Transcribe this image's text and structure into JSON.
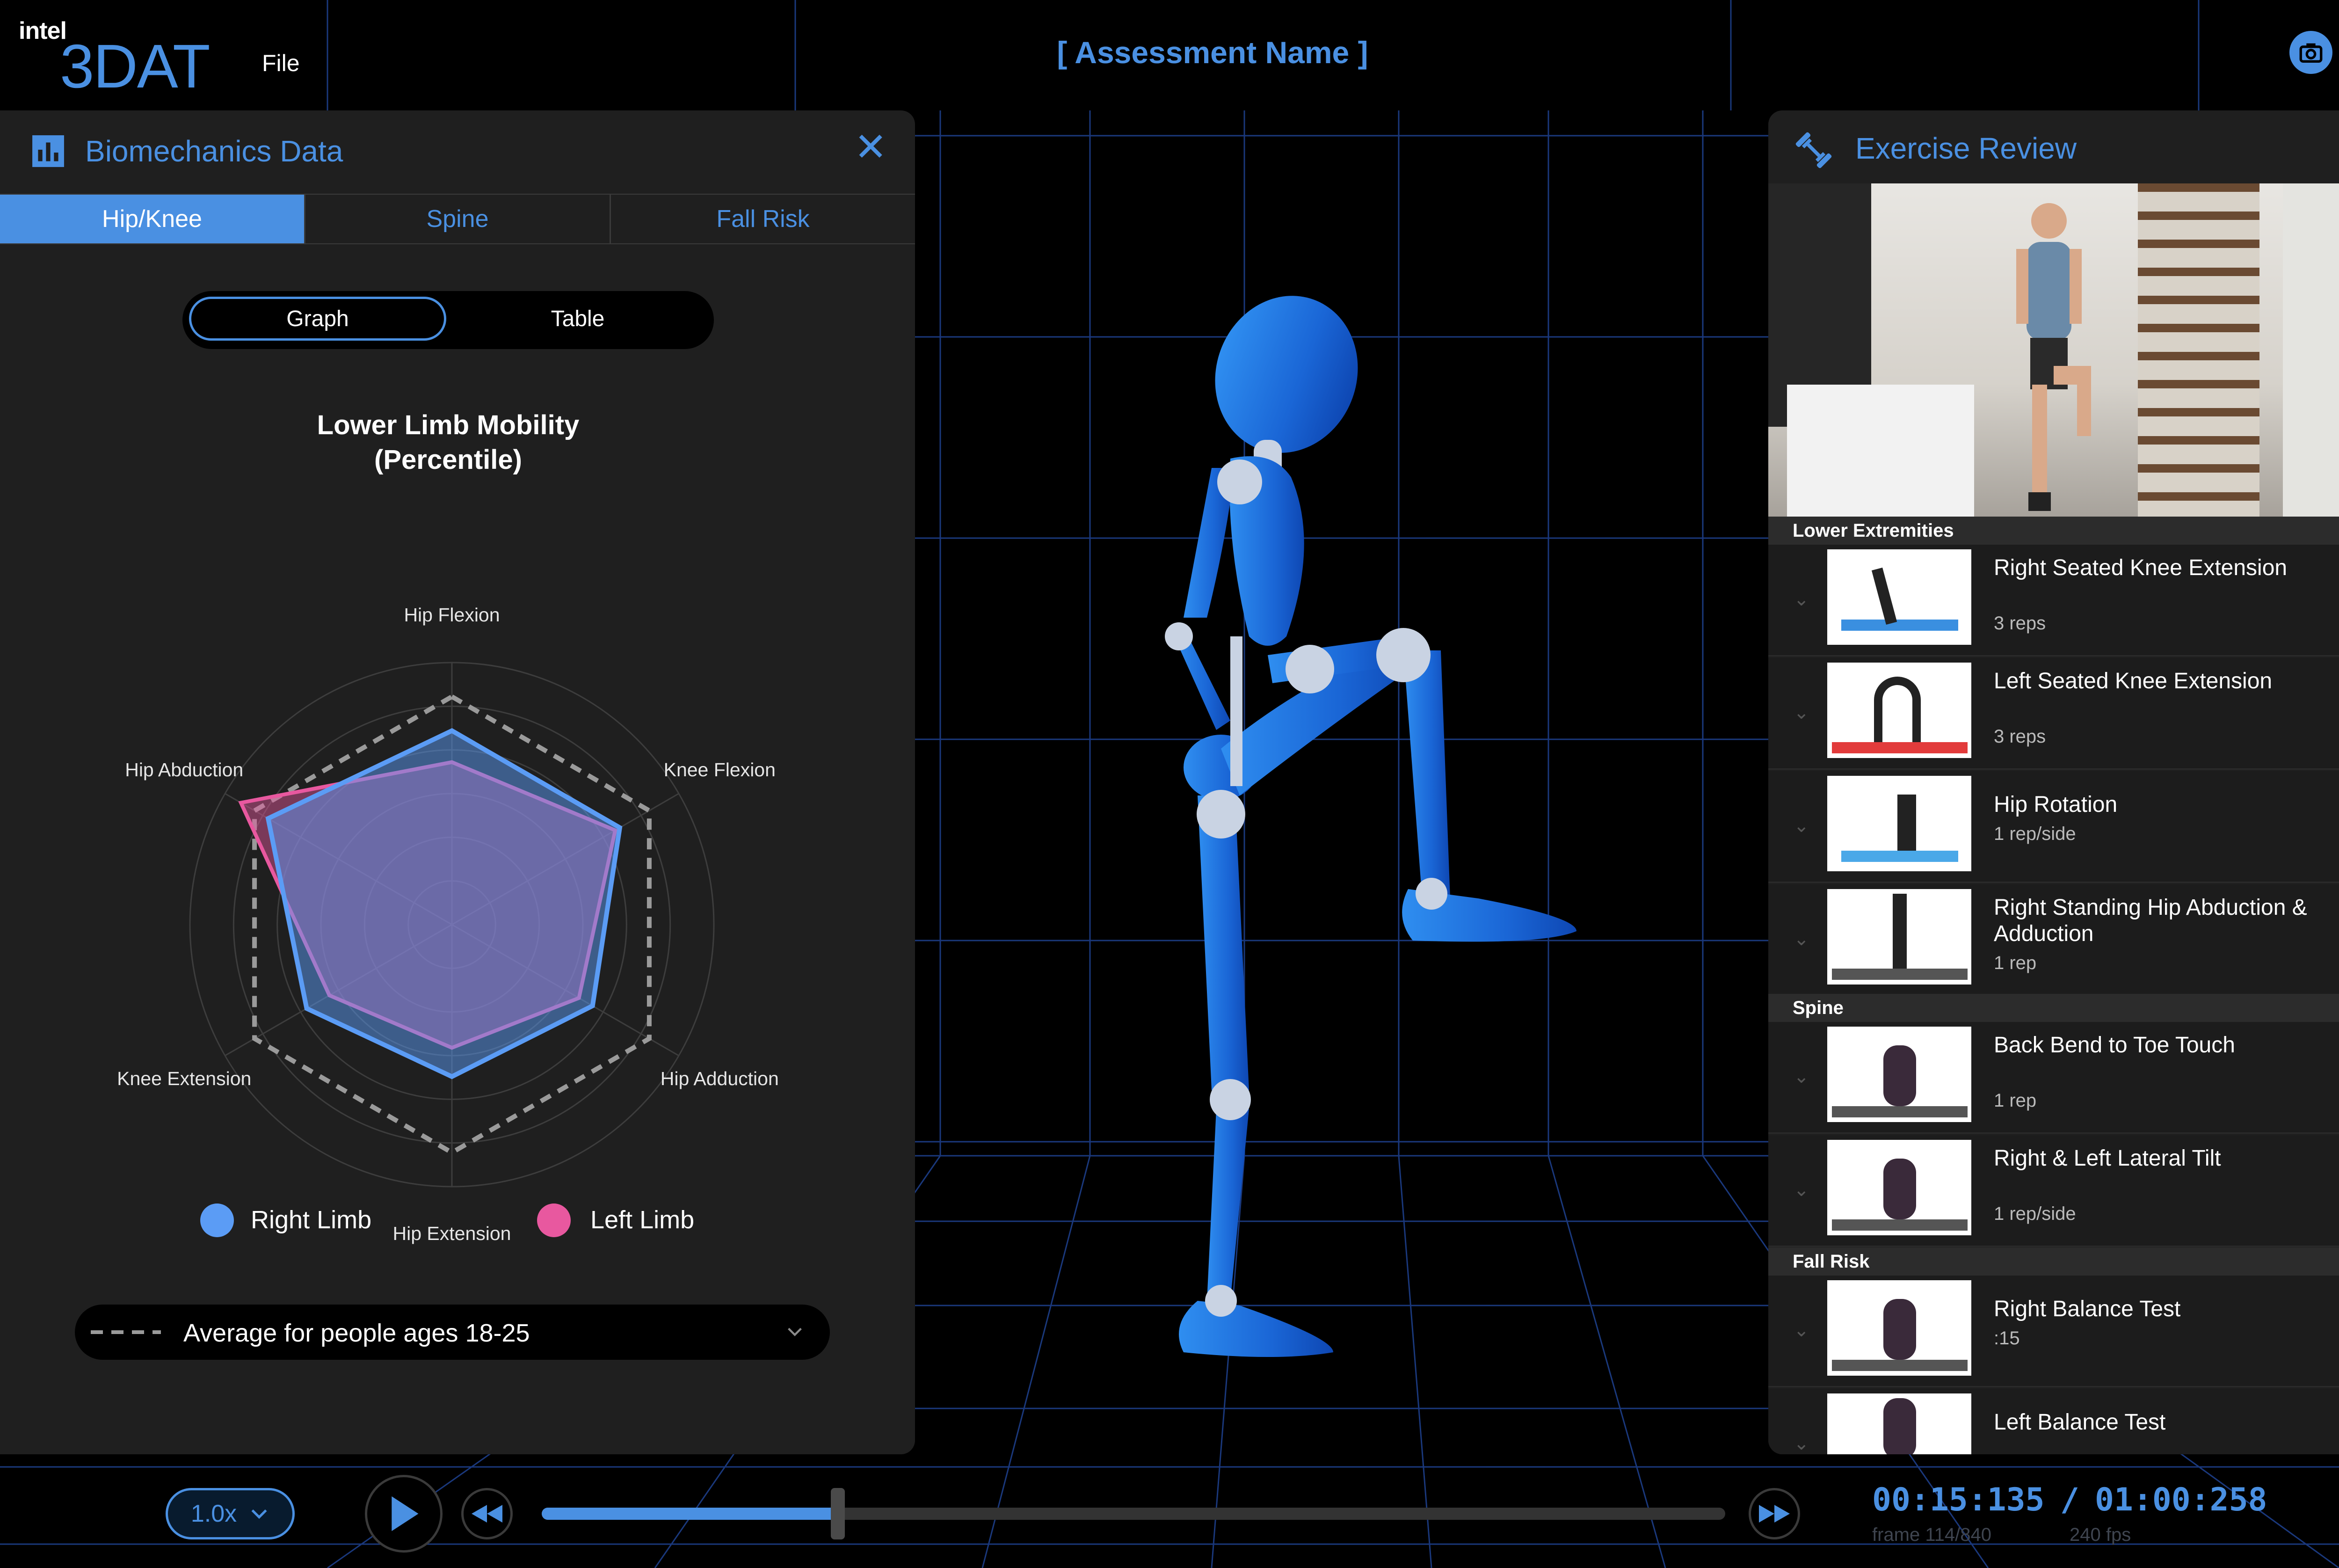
{
  "app": {
    "brand": "intel",
    "name": "3DAT",
    "file_menu": "File",
    "assessment_name": "[ Assessment Name ]"
  },
  "top_icons": [
    "camera-icon",
    "user-account-icon"
  ],
  "left_panel": {
    "title": "Biomechanics Data",
    "tabs": [
      "Hip/Knee",
      "Spine",
      "Fall Risk"
    ],
    "active_tab": "Hip/Knee",
    "view_toggle": {
      "graph": "Graph",
      "table": "Table",
      "active": "Graph"
    },
    "legend": {
      "right": "Right Limb",
      "left": "Left Limb"
    },
    "comparison": "Average for people ages 18-25"
  },
  "chart_data": {
    "type": "radar",
    "title_line1": "Lower Limb Mobility",
    "title_line2": "(Percentile)",
    "axes": [
      "Hip Flexion",
      "Knee Flexion",
      "Hip Adduction",
      "Hip Extension",
      "Knee Extension",
      "Hip Abduction"
    ],
    "range": [
      0,
      100
    ],
    "series": [
      {
        "name": "Right Limb",
        "color": "#5b9cf5",
        "values": [
          74,
          74,
          62,
          58,
          64,
          81
        ]
      },
      {
        "name": "Left Limb",
        "color": "#e8589f",
        "values": [
          62,
          72,
          56,
          47,
          54,
          93
        ]
      },
      {
        "name": "Average for people ages 18-25",
        "style": "dashed",
        "color": "#9a9a9a",
        "values": [
          87,
          87,
          87,
          87,
          87,
          87
        ]
      }
    ],
    "rings": 6
  },
  "right_panel": {
    "title": "Exercise Review",
    "sections": [
      {
        "name": "Lower Extremities",
        "items": [
          {
            "name": "Right Seated Knee Extension",
            "detail": "3 reps",
            "mat": "#3a8fe0"
          },
          {
            "name": "Left Seated Knee Extension",
            "detail": "3 reps",
            "mat": "#e23b3b"
          },
          {
            "name": "Hip Rotation",
            "detail": "1 rep/side",
            "mat": "#4aa8e8"
          },
          {
            "name": "Right Standing Hip Abduction & Adduction",
            "detail": "1 rep",
            "mat": "#555555"
          }
        ]
      },
      {
        "name": "Spine",
        "items": [
          {
            "name": "Back Bend to Toe Touch",
            "detail": "1 rep",
            "mat": "#555555"
          },
          {
            "name": "Right & Left Lateral Tilt",
            "detail": "1 rep/side",
            "mat": "#555555"
          }
        ]
      },
      {
        "name": "Fall Risk",
        "items": [
          {
            "name": "Right Balance Test",
            "detail": ":15",
            "mat": "#555555"
          },
          {
            "name": "Left Balance Test",
            "detail": "",
            "mat": "#555555"
          }
        ]
      }
    ]
  },
  "playback": {
    "speed": "1.0x",
    "progress": 0.25,
    "current_time": "00:15:135",
    "separator": "/",
    "total_time": "01:00:258",
    "frame_info": "frame 114/840",
    "fps_info": "240 fps"
  },
  "colors": {
    "accent": "#4a90e2",
    "right_limb": "#5b9cf5",
    "left_limb": "#e8589f",
    "panel": "#1f1f1f",
    "grid": "#1d3f8a"
  }
}
